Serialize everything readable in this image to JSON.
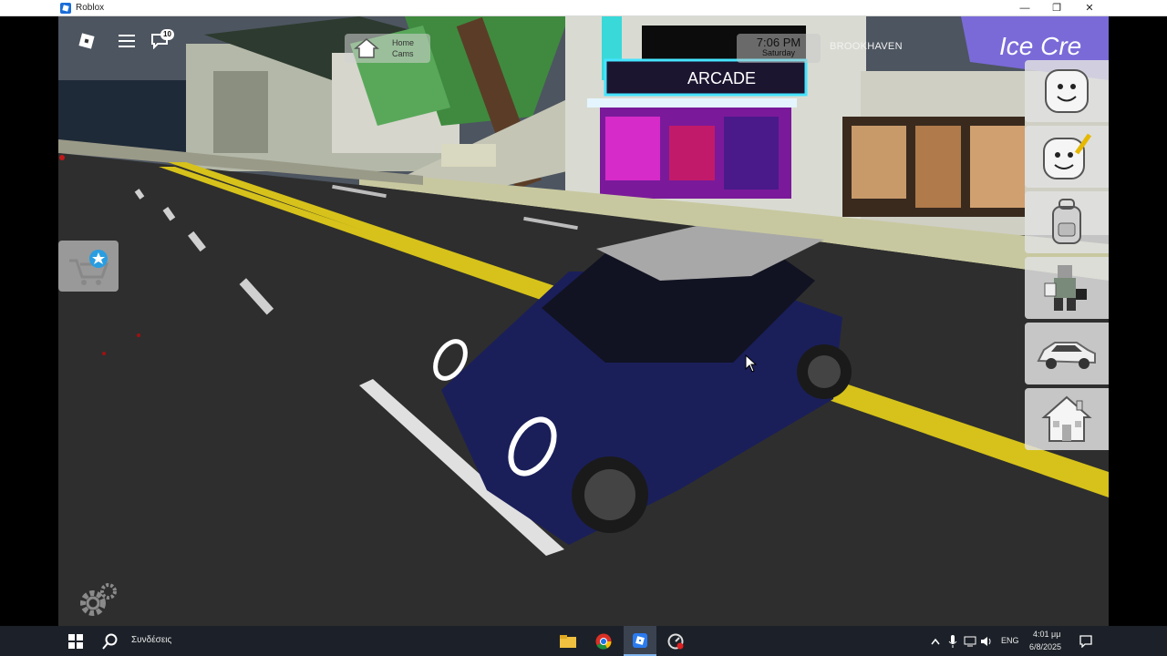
{
  "window": {
    "title": "Roblox",
    "controls": {
      "minimize": "—",
      "restore": "❐",
      "close": "✕"
    }
  },
  "hud": {
    "chat_badge": "10",
    "home_cams": {
      "line1": "Home",
      "line2": "Cams"
    },
    "clock": {
      "time": "7:06 PM",
      "day": "Saturday"
    },
    "place_name": "BROOKHAVEN"
  },
  "scene_signs": {
    "arcade": "ARCADE",
    "ice_cream": "Ice Cre"
  },
  "side_menu": [
    "avatar-icon",
    "avatar-editor-icon",
    "backpack-icon",
    "roleplay-icon",
    "vehicle-icon",
    "house-icon"
  ],
  "taskbar": {
    "search_label": "Συνδέσεις",
    "language": "ENG",
    "time": "4:01 μμ",
    "date": "6/8/2025"
  },
  "colors": {
    "taskbar": "#1c2129",
    "car_body": "#1a1f5a",
    "road_line": "#d6c21a",
    "arcade_neon": "#ff33dd"
  }
}
